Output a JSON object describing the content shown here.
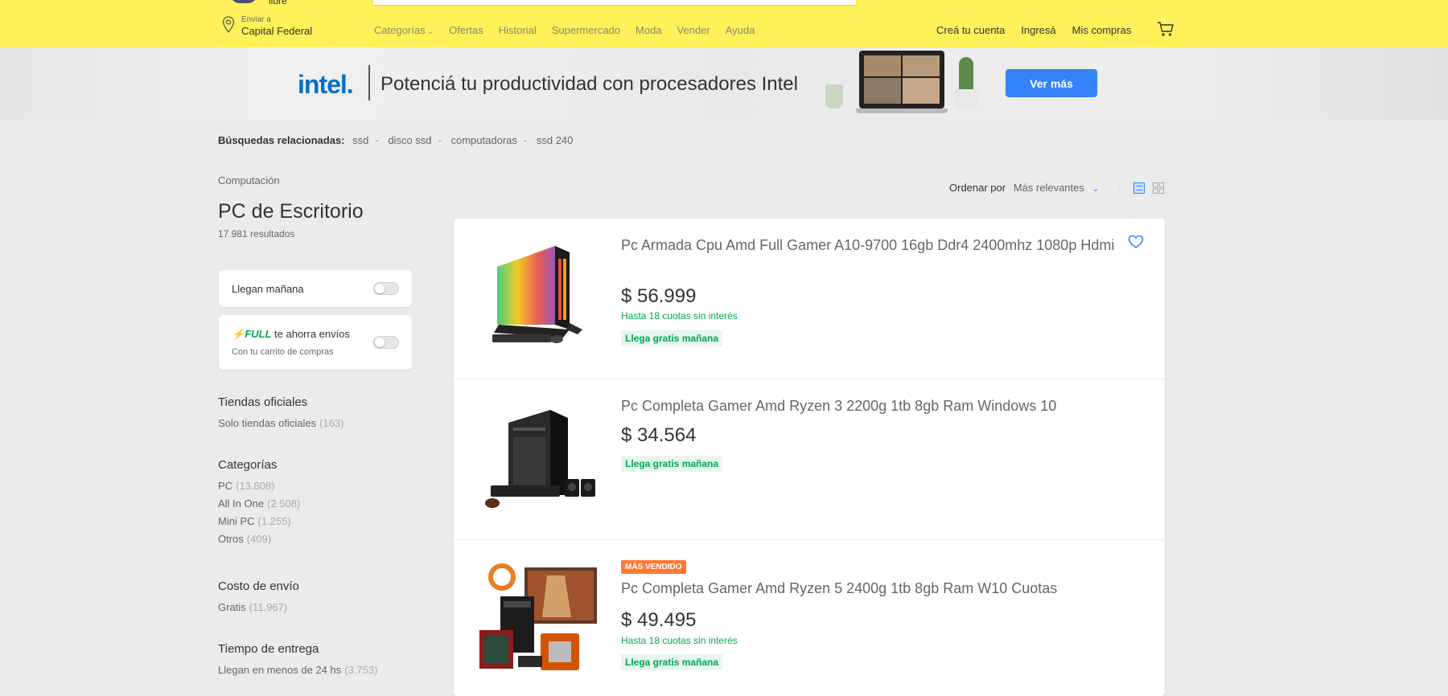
{
  "header": {
    "logo_text": "libre",
    "location": {
      "prefix": "Enviar a",
      "city": "Capital Federal"
    },
    "nav": [
      "Categorías",
      "Ofertas",
      "Historial",
      "Supermercado",
      "Moda",
      "Vender",
      "Ayuda"
    ],
    "user_nav": [
      "Creá tu cuenta",
      "Ingresá",
      "Mis compras"
    ]
  },
  "banner": {
    "brand": "intel.",
    "text": "Potenciá tu productividad con procesadores Intel",
    "cta": "Ver más",
    "cta_color": "#3483fa"
  },
  "related": {
    "label": "Búsquedas relacionadas:",
    "items": [
      "ssd",
      "disco ssd",
      "computadoras",
      "ssd 240"
    ]
  },
  "sidebar": {
    "breadcrumb": "Computación",
    "title": "PC de Escritorio",
    "results": "17.981 resultados",
    "filters": {
      "llegan_manana": "Llegan mañana",
      "full_brand": "FULL",
      "full_text": "te ahorra envíos",
      "full_sub": "Con tu carrito de compras"
    },
    "tiendas": {
      "title": "Tiendas oficiales",
      "label": "Solo tiendas oficiales",
      "count": "(163)"
    },
    "categorias": {
      "title": "Categorías",
      "items": [
        {
          "label": "PC",
          "count": "(13.808)"
        },
        {
          "label": "All In One",
          "count": "(2.508)"
        },
        {
          "label": "Mini PC",
          "count": "(1.255)"
        },
        {
          "label": "Otros",
          "count": "(409)"
        }
      ]
    },
    "envio": {
      "title": "Costo de envío",
      "label": "Gratis",
      "count": "(11.967)"
    },
    "entrega": {
      "title": "Tiempo de entrega",
      "label": "Llegan en menos de 24 hs",
      "count": "(3.753)"
    }
  },
  "sort": {
    "label": "Ordenar por",
    "value": "Más relevantes"
  },
  "products": [
    {
      "title": "Pc Armada Cpu Amd Full Gamer A10-9700 16gb Ddr4 2400mhz 1080p Hdmi",
      "price": "$ 56.999",
      "installments": "Hasta 18 cuotas sin interés",
      "shipping": "Llega gratis mañana",
      "image": "gaming-pc-rgb-icon"
    },
    {
      "title": "Pc Completa Gamer Amd Ryzen 3 2200g 1tb 8gb Ram Windows 10",
      "price": "$ 34.564",
      "shipping": "Llega gratis mañana",
      "image": "pc-tower-black-icon"
    },
    {
      "badge": "MÁS VENDIDO",
      "title": "Pc Completa Gamer Amd Ryzen 5 2400g 1tb 8gb Ram W10 Cuotas",
      "price": "$ 49.495",
      "installments": "Hasta 18 cuotas sin interés",
      "shipping": "Llega gratis mañana",
      "image": "pc-combo-ryzen-icon"
    }
  ],
  "colors": {
    "header_bg": "#fff159",
    "accent_blue": "#3483fa",
    "green": "#00a650",
    "badge_orange": "#ff7733"
  }
}
